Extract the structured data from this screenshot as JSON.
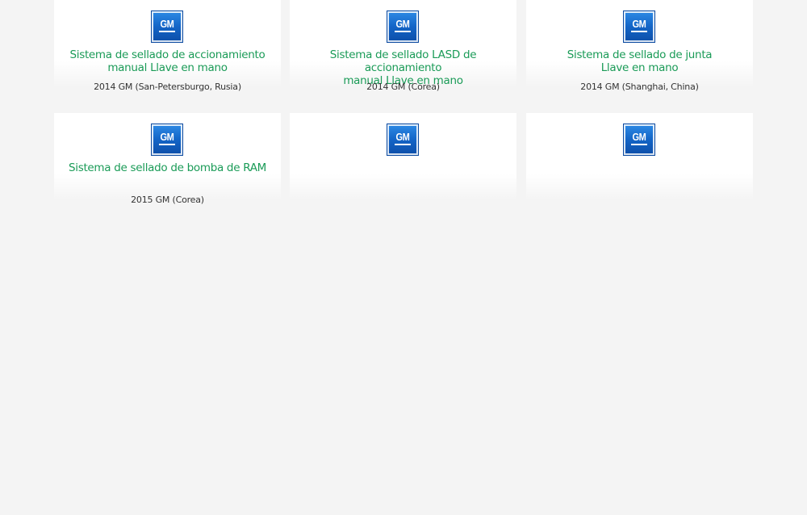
{
  "cards": [
    {
      "logo_text": "GM",
      "title_line1": "Sistema de sellado de accionamiento",
      "title_line2": "manual Llave en mano",
      "meta": "2014 GM (San-Petersburgo, Rusia)"
    },
    {
      "logo_text": "GM",
      "title_line1": "Sistema de sellado LASD de accionamiento",
      "title_line2": "manual Llave en mano",
      "meta": "2014 GM (Corea)"
    },
    {
      "logo_text": "GM",
      "title_line1": "Sistema de sellado de junta",
      "title_line2": "Llave en mano",
      "meta": "2014 GM (Shanghai, China)"
    },
    {
      "logo_text": "GM",
      "title_line1": "Sistema de sellado de bomba de RAM",
      "title_line2": "",
      "meta": "2015 GM (Corea)"
    },
    {
      "logo_text": "GM",
      "title_line1": "",
      "title_line2": "",
      "meta": ""
    },
    {
      "logo_text": "GM",
      "title_line1": "",
      "title_line2": "",
      "meta": ""
    }
  ],
  "colors": {
    "title_green": "#1a9b57",
    "logo_blue": "#1466c8",
    "background": "#f4f4f4"
  }
}
